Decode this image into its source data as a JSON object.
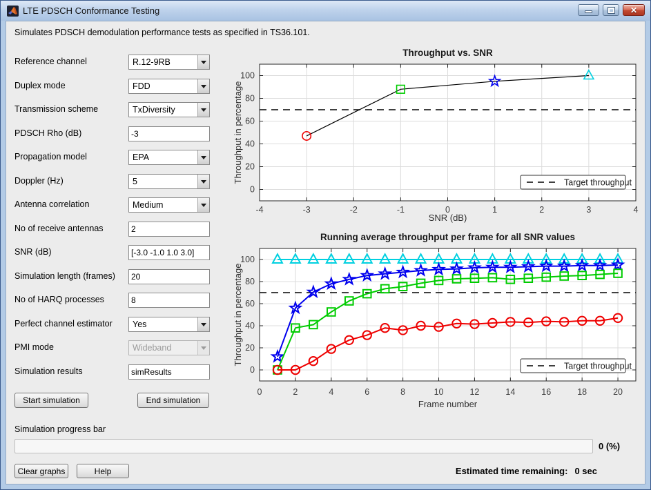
{
  "window": {
    "title": "LTE PDSCH Conformance Testing"
  },
  "description": "Simulates PDSCH demodulation performance tests as specified in TS36.101.",
  "form": {
    "fields": [
      {
        "label": "Reference channel",
        "value": "R.12-9RB",
        "control": "dropdown"
      },
      {
        "label": "Duplex mode",
        "value": "FDD",
        "control": "dropdown"
      },
      {
        "label": "Transmission scheme",
        "value": "TxDiversity",
        "control": "dropdown"
      },
      {
        "label": "PDSCH Rho (dB)",
        "value": "-3",
        "control": "input"
      },
      {
        "label": "Propagation model",
        "value": "EPA",
        "control": "dropdown"
      },
      {
        "label": "Doppler (Hz)",
        "value": "5",
        "control": "dropdown"
      },
      {
        "label": "Antenna correlation",
        "value": "Medium",
        "control": "dropdown"
      },
      {
        "label": "No of receive antennas",
        "value": "2",
        "control": "input"
      },
      {
        "label": "SNR (dB)",
        "value": "[-3.0 -1.0 1.0 3.0]",
        "control": "input"
      },
      {
        "label": "Simulation length (frames)",
        "value": "20",
        "control": "input"
      },
      {
        "label": "No of HARQ processes",
        "value": "8",
        "control": "input"
      },
      {
        "label": "Perfect channel estimator",
        "value": "Yes",
        "control": "dropdown"
      },
      {
        "label": "PMI mode",
        "value": "Wideband",
        "control": "dropdown",
        "disabled": true
      },
      {
        "label": "Simulation results",
        "value": "simResults",
        "control": "input"
      }
    ],
    "start_button": "Start simulation",
    "end_button": "End simulation"
  },
  "progress": {
    "label": "Simulation progress bar",
    "percent": "0 (%)",
    "clear_button": "Clear graphs",
    "help_button": "Help",
    "eta_label": "Estimated time remaining:",
    "eta_value": "0 sec"
  },
  "chart_data": [
    {
      "type": "line",
      "title": "Throughput vs. SNR",
      "xlabel": "SNR (dB)",
      "ylabel": "Throughput in percentage",
      "xlim": [
        -4,
        4
      ],
      "ylim": [
        -10,
        110
      ],
      "xticks": [
        -4,
        -3,
        -2,
        -1,
        0,
        1,
        2,
        3,
        4
      ],
      "yticks": [
        0,
        20,
        40,
        60,
        80,
        100
      ],
      "grid": true,
      "line_color": "#000000",
      "x": [
        -3,
        -1,
        1,
        3
      ],
      "y": [
        47,
        88,
        95,
        100
      ],
      "markers": [
        {
          "shape": "circle",
          "color": "#ee0000"
        },
        {
          "shape": "square",
          "color": "#00cc00"
        },
        {
          "shape": "pentagram",
          "color": "#0000ee"
        },
        {
          "shape": "triangle",
          "color": "#00d0e0"
        }
      ],
      "target_line": {
        "value": 70,
        "label": "Target throughput",
        "style": "dashed",
        "color": "#000000"
      },
      "legend_position": "bottom-right"
    },
    {
      "type": "line",
      "title": "Running average throughput per frame for all SNR values",
      "xlabel": "Frame number",
      "ylabel": "Throughput in percentage",
      "xlim": [
        0,
        21
      ],
      "ylim": [
        -10,
        110
      ],
      "xticks": [
        0,
        2,
        4,
        6,
        8,
        10,
        12,
        14,
        16,
        18,
        20
      ],
      "yticks": [
        0,
        20,
        40,
        60,
        80,
        100
      ],
      "grid": true,
      "x": [
        1,
        2,
        3,
        4,
        5,
        6,
        7,
        8,
        9,
        10,
        11,
        12,
        13,
        14,
        15,
        16,
        17,
        18,
        19,
        20
      ],
      "series": [
        {
          "snr_db": 3.0,
          "marker": "triangle",
          "color": "#00d0e0",
          "values": [
            100,
            100,
            100,
            100,
            100,
            100,
            100,
            100,
            100,
            100,
            100,
            100,
            100,
            100,
            100,
            100,
            100,
            100,
            100,
            100
          ]
        },
        {
          "snr_db": 1.0,
          "marker": "pentagram",
          "color": "#0000ee",
          "values": [
            12,
            56,
            70.5,
            78,
            82,
            85.5,
            87,
            88.5,
            90,
            91,
            91.5,
            92.5,
            93,
            93,
            93.5,
            94,
            94,
            94.5,
            94.5,
            95
          ]
        },
        {
          "snr_db": -1.0,
          "marker": "square",
          "color": "#00cc00",
          "values": [
            0,
            38,
            41,
            52.5,
            62.5,
            69,
            73.5,
            75.5,
            78.5,
            81,
            82.5,
            83,
            83.5,
            82,
            83,
            84,
            85,
            85.5,
            86.5,
            87.5
          ]
        },
        {
          "snr_db": -3.0,
          "marker": "circle",
          "color": "#ee0000",
          "values": [
            0,
            0,
            8,
            19,
            27,
            31.5,
            38,
            36,
            40,
            39,
            42,
            41.5,
            42.5,
            43.5,
            43,
            44,
            43.5,
            44.5,
            44.5,
            47
          ]
        }
      ],
      "target_line": {
        "value": 70,
        "label": "Target throughput",
        "style": "dashed",
        "color": "#000000"
      },
      "legend_position": "bottom-right"
    }
  ]
}
